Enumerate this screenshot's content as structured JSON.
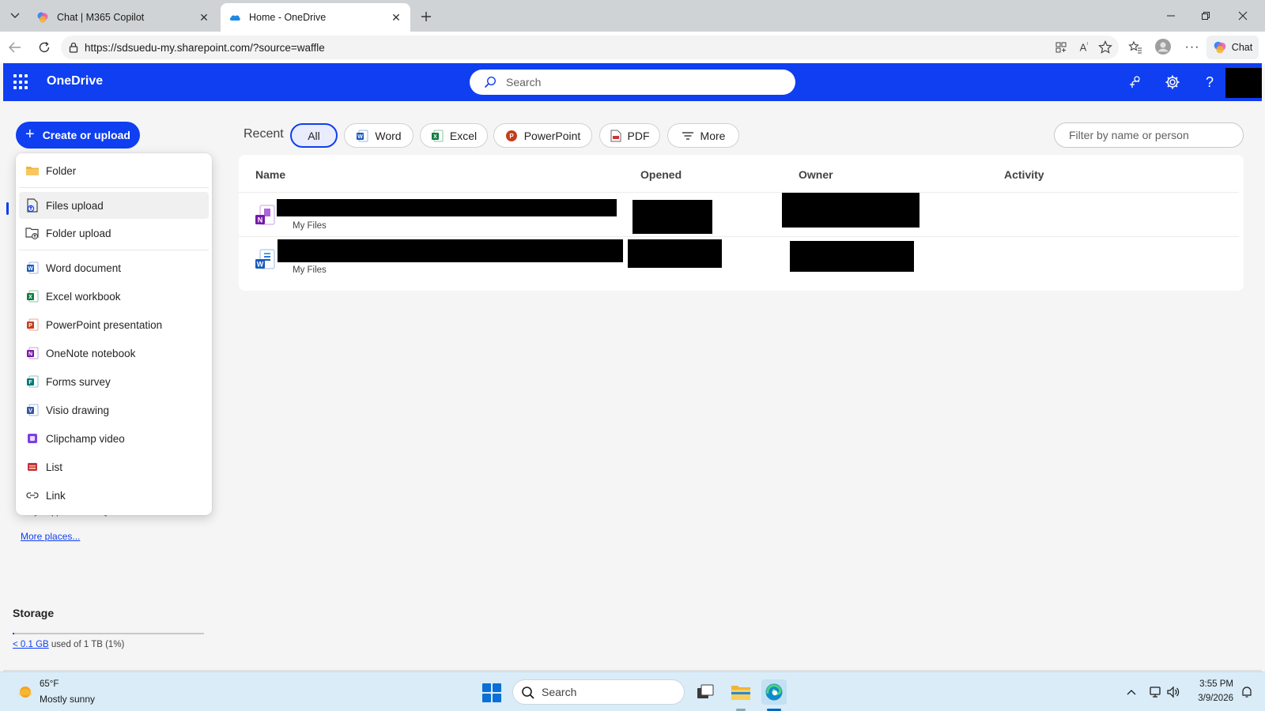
{
  "browser": {
    "tabs": [
      {
        "title": "Chat | M365 Copilot",
        "favicon": "copilot-icon",
        "active": false
      },
      {
        "title": "Home - OneDrive",
        "favicon": "onedrive-cloud-icon",
        "active": true
      }
    ],
    "url": "https://sdsuedu-my.sharepoint.com/?source=waffle",
    "chat_label": "Chat"
  },
  "suite": {
    "app_name": "OneDrive",
    "search_placeholder": "Search"
  },
  "create": {
    "button_label": "Create or upload"
  },
  "menu": {
    "items": [
      {
        "label": "Folder",
        "icon": "folder-icon"
      },
      {
        "label": "Files upload",
        "icon": "file-upload-icon"
      },
      {
        "label": "Folder upload",
        "icon": "folder-upload-icon"
      },
      {
        "label": "Word document",
        "icon": "word-icon"
      },
      {
        "label": "Excel workbook",
        "icon": "excel-icon"
      },
      {
        "label": "PowerPoint presentation",
        "icon": "powerpoint-icon"
      },
      {
        "label": "OneNote notebook",
        "icon": "onenote-icon"
      },
      {
        "label": "Forms survey",
        "icon": "forms-icon"
      },
      {
        "label": "Visio drawing",
        "icon": "visio-icon"
      },
      {
        "label": "Clipchamp video",
        "icon": "clipchamp-icon"
      },
      {
        "label": "List",
        "icon": "list-icon"
      },
      {
        "label": "Link",
        "icon": "link-icon"
      }
    ]
  },
  "left": {
    "hint_text": "they'll appear in this Quick access list.",
    "more_places": "More places...",
    "storage_title": "Storage",
    "storage_used": "< 0.1 GB",
    "storage_rest": " used of 1 TB (1%)",
    "storage_fraction": 0.01
  },
  "filters": {
    "recent_label": "Recent",
    "chips": [
      "All",
      "Word",
      "Excel",
      "PowerPoint",
      "PDF",
      "More"
    ],
    "filter_placeholder": "Filter by name or person"
  },
  "files": {
    "columns": [
      "Name",
      "Opened",
      "Owner",
      "Activity"
    ],
    "rows": [
      {
        "type": "onenote",
        "location": "My Files"
      },
      {
        "type": "word",
        "location": "My Files"
      }
    ]
  },
  "taskbar": {
    "weather_temp": "65°F",
    "weather_desc": "Mostly sunny",
    "search_placeholder": "Search",
    "time": "3:55 PM",
    "date": "3/9/2026"
  },
  "colors": {
    "brand": "#0f3ff0",
    "word": "#185abd",
    "excel": "#107c41",
    "powerpoint": "#c43e1c",
    "onenote": "#7719aa"
  }
}
